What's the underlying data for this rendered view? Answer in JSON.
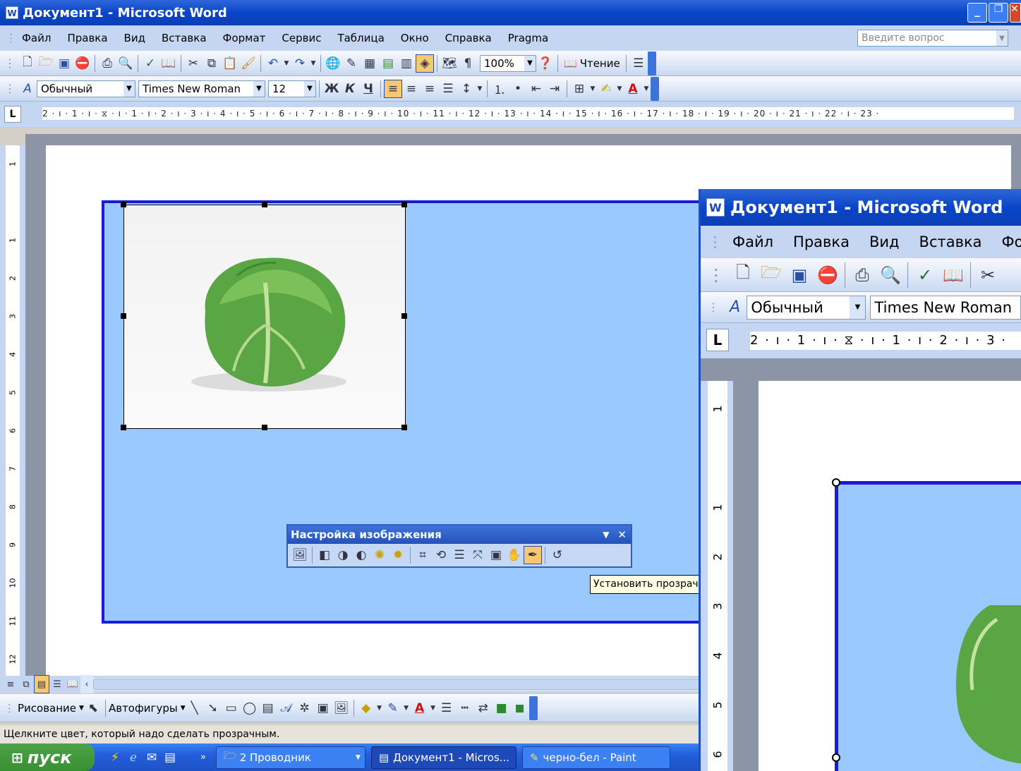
{
  "window": {
    "title": "Документ1 - Microsoft Word"
  },
  "menu": {
    "items": [
      "Файл",
      "Правка",
      "Вид",
      "Вставка",
      "Формат",
      "Сервис",
      "Таблица",
      "Окно",
      "Справка",
      "Pragma"
    ],
    "help_placeholder": "Введите вопрос"
  },
  "standard_toolbar": {
    "zoom": "100%",
    "reading_label": "Чтение"
  },
  "format_toolbar": {
    "style": "Обычный",
    "font": "Times New Roman",
    "size": "12",
    "bold": "Ж",
    "italic": "К",
    "underline": "Ч"
  },
  "ruler": {
    "text": "2 · ı · 1 · ı · ⧖ · ı · 1 · ı · 2 · ı · 3 · ı · 4 · ı · 5 · ı · 6 · ı · 7 · ı · 8 · ı · 9 · ı · 10 · ı · 11 · ı · 12 · ı · 13 · ı · 14 · ı · 15 · ı · 16 · ı · 17 · ı · 18 · ı · 19 · ı · 20 · ı · 21 · ı · 22 · ı · 23 ·",
    "tab_symbol": "L"
  },
  "vruler": {
    "numbers": [
      "1",
      "1",
      "2",
      "3",
      "4",
      "5",
      "6",
      "7",
      "8",
      "9",
      "10",
      "11",
      "12"
    ]
  },
  "picture_toolbar": {
    "title": "Настройка изображения"
  },
  "tooltip": {
    "text": "Установить прозрачный цвет"
  },
  "drawing_toolbar": {
    "draw_label": "Рисование",
    "autoshapes_label": "Автофигуры"
  },
  "status": {
    "text": "Щелкните цвет, который надо сделать прозрачным."
  },
  "taskbar": {
    "start": "пуск",
    "tasks": [
      "2 Проводник",
      "Документ1 - Micros...",
      "черно-бел - Paint"
    ]
  },
  "window2": {
    "title": "Документ1 - Microsoft Word",
    "menu": [
      "Файл",
      "Правка",
      "Вид",
      "Вставка",
      "Формат"
    ],
    "style": "Обычный",
    "font": "Times New Roman",
    "ruler_text": "2 · ı · 1 · ı · ⧖ · ı · 1 · ı · 2 · ı · 3 ·",
    "vruler_numbers": [
      "1",
      "1",
      "2",
      "3",
      "4",
      "5",
      "6"
    ]
  },
  "colors": {
    "accent": "#0a45c8",
    "canvas": "#99c9ff",
    "frame": "#1a1ad8",
    "lettuce": "#5aa544"
  }
}
